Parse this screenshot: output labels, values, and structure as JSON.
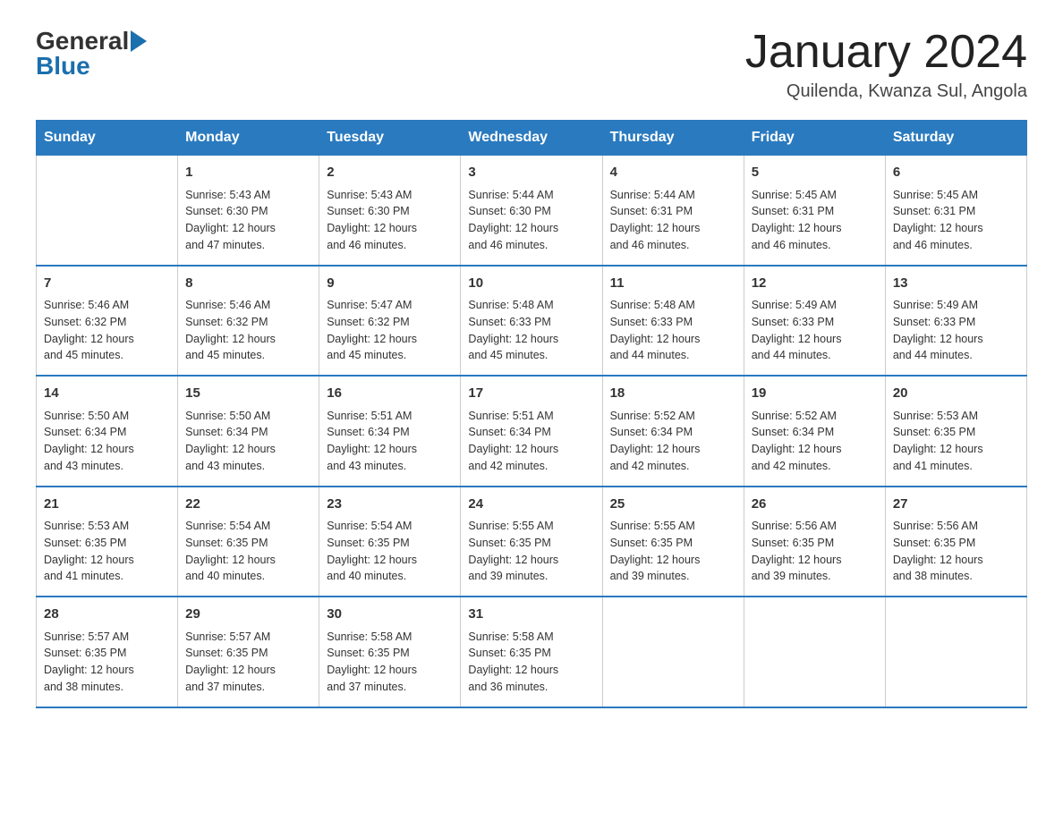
{
  "logo": {
    "general": "General",
    "blue": "Blue"
  },
  "header": {
    "title": "January 2024",
    "location": "Quilenda, Kwanza Sul, Angola"
  },
  "days_of_week": [
    "Sunday",
    "Monday",
    "Tuesday",
    "Wednesday",
    "Thursday",
    "Friday",
    "Saturday"
  ],
  "weeks": [
    [
      {
        "day": "",
        "info": ""
      },
      {
        "day": "1",
        "info": "Sunrise: 5:43 AM\nSunset: 6:30 PM\nDaylight: 12 hours\nand 47 minutes."
      },
      {
        "day": "2",
        "info": "Sunrise: 5:43 AM\nSunset: 6:30 PM\nDaylight: 12 hours\nand 46 minutes."
      },
      {
        "day": "3",
        "info": "Sunrise: 5:44 AM\nSunset: 6:30 PM\nDaylight: 12 hours\nand 46 minutes."
      },
      {
        "day": "4",
        "info": "Sunrise: 5:44 AM\nSunset: 6:31 PM\nDaylight: 12 hours\nand 46 minutes."
      },
      {
        "day": "5",
        "info": "Sunrise: 5:45 AM\nSunset: 6:31 PM\nDaylight: 12 hours\nand 46 minutes."
      },
      {
        "day": "6",
        "info": "Sunrise: 5:45 AM\nSunset: 6:31 PM\nDaylight: 12 hours\nand 46 minutes."
      }
    ],
    [
      {
        "day": "7",
        "info": "Sunrise: 5:46 AM\nSunset: 6:32 PM\nDaylight: 12 hours\nand 45 minutes."
      },
      {
        "day": "8",
        "info": "Sunrise: 5:46 AM\nSunset: 6:32 PM\nDaylight: 12 hours\nand 45 minutes."
      },
      {
        "day": "9",
        "info": "Sunrise: 5:47 AM\nSunset: 6:32 PM\nDaylight: 12 hours\nand 45 minutes."
      },
      {
        "day": "10",
        "info": "Sunrise: 5:48 AM\nSunset: 6:33 PM\nDaylight: 12 hours\nand 45 minutes."
      },
      {
        "day": "11",
        "info": "Sunrise: 5:48 AM\nSunset: 6:33 PM\nDaylight: 12 hours\nand 44 minutes."
      },
      {
        "day": "12",
        "info": "Sunrise: 5:49 AM\nSunset: 6:33 PM\nDaylight: 12 hours\nand 44 minutes."
      },
      {
        "day": "13",
        "info": "Sunrise: 5:49 AM\nSunset: 6:33 PM\nDaylight: 12 hours\nand 44 minutes."
      }
    ],
    [
      {
        "day": "14",
        "info": "Sunrise: 5:50 AM\nSunset: 6:34 PM\nDaylight: 12 hours\nand 43 minutes."
      },
      {
        "day": "15",
        "info": "Sunrise: 5:50 AM\nSunset: 6:34 PM\nDaylight: 12 hours\nand 43 minutes."
      },
      {
        "day": "16",
        "info": "Sunrise: 5:51 AM\nSunset: 6:34 PM\nDaylight: 12 hours\nand 43 minutes."
      },
      {
        "day": "17",
        "info": "Sunrise: 5:51 AM\nSunset: 6:34 PM\nDaylight: 12 hours\nand 42 minutes."
      },
      {
        "day": "18",
        "info": "Sunrise: 5:52 AM\nSunset: 6:34 PM\nDaylight: 12 hours\nand 42 minutes."
      },
      {
        "day": "19",
        "info": "Sunrise: 5:52 AM\nSunset: 6:34 PM\nDaylight: 12 hours\nand 42 minutes."
      },
      {
        "day": "20",
        "info": "Sunrise: 5:53 AM\nSunset: 6:35 PM\nDaylight: 12 hours\nand 41 minutes."
      }
    ],
    [
      {
        "day": "21",
        "info": "Sunrise: 5:53 AM\nSunset: 6:35 PM\nDaylight: 12 hours\nand 41 minutes."
      },
      {
        "day": "22",
        "info": "Sunrise: 5:54 AM\nSunset: 6:35 PM\nDaylight: 12 hours\nand 40 minutes."
      },
      {
        "day": "23",
        "info": "Sunrise: 5:54 AM\nSunset: 6:35 PM\nDaylight: 12 hours\nand 40 minutes."
      },
      {
        "day": "24",
        "info": "Sunrise: 5:55 AM\nSunset: 6:35 PM\nDaylight: 12 hours\nand 39 minutes."
      },
      {
        "day": "25",
        "info": "Sunrise: 5:55 AM\nSunset: 6:35 PM\nDaylight: 12 hours\nand 39 minutes."
      },
      {
        "day": "26",
        "info": "Sunrise: 5:56 AM\nSunset: 6:35 PM\nDaylight: 12 hours\nand 39 minutes."
      },
      {
        "day": "27",
        "info": "Sunrise: 5:56 AM\nSunset: 6:35 PM\nDaylight: 12 hours\nand 38 minutes."
      }
    ],
    [
      {
        "day": "28",
        "info": "Sunrise: 5:57 AM\nSunset: 6:35 PM\nDaylight: 12 hours\nand 38 minutes."
      },
      {
        "day": "29",
        "info": "Sunrise: 5:57 AM\nSunset: 6:35 PM\nDaylight: 12 hours\nand 37 minutes."
      },
      {
        "day": "30",
        "info": "Sunrise: 5:58 AM\nSunset: 6:35 PM\nDaylight: 12 hours\nand 37 minutes."
      },
      {
        "day": "31",
        "info": "Sunrise: 5:58 AM\nSunset: 6:35 PM\nDaylight: 12 hours\nand 36 minutes."
      },
      {
        "day": "",
        "info": ""
      },
      {
        "day": "",
        "info": ""
      },
      {
        "day": "",
        "info": ""
      }
    ]
  ]
}
